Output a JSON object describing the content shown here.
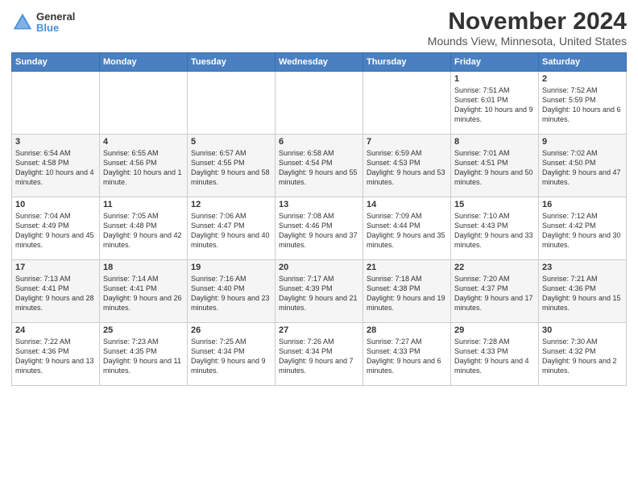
{
  "logo": {
    "general": "General",
    "blue": "Blue"
  },
  "title": "November 2024",
  "subtitle": "Mounds View, Minnesota, United States",
  "days_of_week": [
    "Sunday",
    "Monday",
    "Tuesday",
    "Wednesday",
    "Thursday",
    "Friday",
    "Saturday"
  ],
  "weeks": [
    [
      {
        "day": "",
        "info": ""
      },
      {
        "day": "",
        "info": ""
      },
      {
        "day": "",
        "info": ""
      },
      {
        "day": "",
        "info": ""
      },
      {
        "day": "",
        "info": ""
      },
      {
        "day": "1",
        "info": "Sunrise: 7:51 AM\nSunset: 6:01 PM\nDaylight: 10 hours and 9 minutes."
      },
      {
        "day": "2",
        "info": "Sunrise: 7:52 AM\nSunset: 5:59 PM\nDaylight: 10 hours and 6 minutes."
      }
    ],
    [
      {
        "day": "3",
        "info": "Sunrise: 6:54 AM\nSunset: 4:58 PM\nDaylight: 10 hours and 4 minutes."
      },
      {
        "day": "4",
        "info": "Sunrise: 6:55 AM\nSunset: 4:56 PM\nDaylight: 10 hours and 1 minute."
      },
      {
        "day": "5",
        "info": "Sunrise: 6:57 AM\nSunset: 4:55 PM\nDaylight: 9 hours and 58 minutes."
      },
      {
        "day": "6",
        "info": "Sunrise: 6:58 AM\nSunset: 4:54 PM\nDaylight: 9 hours and 55 minutes."
      },
      {
        "day": "7",
        "info": "Sunrise: 6:59 AM\nSunset: 4:53 PM\nDaylight: 9 hours and 53 minutes."
      },
      {
        "day": "8",
        "info": "Sunrise: 7:01 AM\nSunset: 4:51 PM\nDaylight: 9 hours and 50 minutes."
      },
      {
        "day": "9",
        "info": "Sunrise: 7:02 AM\nSunset: 4:50 PM\nDaylight: 9 hours and 47 minutes."
      }
    ],
    [
      {
        "day": "10",
        "info": "Sunrise: 7:04 AM\nSunset: 4:49 PM\nDaylight: 9 hours and 45 minutes."
      },
      {
        "day": "11",
        "info": "Sunrise: 7:05 AM\nSunset: 4:48 PM\nDaylight: 9 hours and 42 minutes."
      },
      {
        "day": "12",
        "info": "Sunrise: 7:06 AM\nSunset: 4:47 PM\nDaylight: 9 hours and 40 minutes."
      },
      {
        "day": "13",
        "info": "Sunrise: 7:08 AM\nSunset: 4:46 PM\nDaylight: 9 hours and 37 minutes."
      },
      {
        "day": "14",
        "info": "Sunrise: 7:09 AM\nSunset: 4:44 PM\nDaylight: 9 hours and 35 minutes."
      },
      {
        "day": "15",
        "info": "Sunrise: 7:10 AM\nSunset: 4:43 PM\nDaylight: 9 hours and 33 minutes."
      },
      {
        "day": "16",
        "info": "Sunrise: 7:12 AM\nSunset: 4:42 PM\nDaylight: 9 hours and 30 minutes."
      }
    ],
    [
      {
        "day": "17",
        "info": "Sunrise: 7:13 AM\nSunset: 4:41 PM\nDaylight: 9 hours and 28 minutes."
      },
      {
        "day": "18",
        "info": "Sunrise: 7:14 AM\nSunset: 4:41 PM\nDaylight: 9 hours and 26 minutes."
      },
      {
        "day": "19",
        "info": "Sunrise: 7:16 AM\nSunset: 4:40 PM\nDaylight: 9 hours and 23 minutes."
      },
      {
        "day": "20",
        "info": "Sunrise: 7:17 AM\nSunset: 4:39 PM\nDaylight: 9 hours and 21 minutes."
      },
      {
        "day": "21",
        "info": "Sunrise: 7:18 AM\nSunset: 4:38 PM\nDaylight: 9 hours and 19 minutes."
      },
      {
        "day": "22",
        "info": "Sunrise: 7:20 AM\nSunset: 4:37 PM\nDaylight: 9 hours and 17 minutes."
      },
      {
        "day": "23",
        "info": "Sunrise: 7:21 AM\nSunset: 4:36 PM\nDaylight: 9 hours and 15 minutes."
      }
    ],
    [
      {
        "day": "24",
        "info": "Sunrise: 7:22 AM\nSunset: 4:36 PM\nDaylight: 9 hours and 13 minutes."
      },
      {
        "day": "25",
        "info": "Sunrise: 7:23 AM\nSunset: 4:35 PM\nDaylight: 9 hours and 11 minutes."
      },
      {
        "day": "26",
        "info": "Sunrise: 7:25 AM\nSunset: 4:34 PM\nDaylight: 9 hours and 9 minutes."
      },
      {
        "day": "27",
        "info": "Sunrise: 7:26 AM\nSunset: 4:34 PM\nDaylight: 9 hours and 7 minutes."
      },
      {
        "day": "28",
        "info": "Sunrise: 7:27 AM\nSunset: 4:33 PM\nDaylight: 9 hours and 6 minutes."
      },
      {
        "day": "29",
        "info": "Sunrise: 7:28 AM\nSunset: 4:33 PM\nDaylight: 9 hours and 4 minutes."
      },
      {
        "day": "30",
        "info": "Sunrise: 7:30 AM\nSunset: 4:32 PM\nDaylight: 9 hours and 2 minutes."
      }
    ]
  ]
}
